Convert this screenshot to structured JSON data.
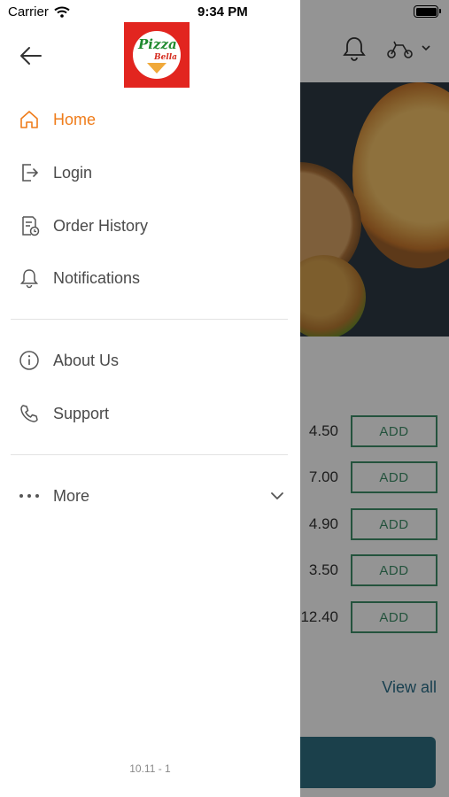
{
  "status_bar": {
    "carrier": "Carrier",
    "time": "9:34 PM"
  },
  "drawer": {
    "items": [
      {
        "label": "Home",
        "icon": "home-icon",
        "active": true
      },
      {
        "label": "Login",
        "icon": "login-icon"
      },
      {
        "label": "Order History",
        "icon": "order-history-icon"
      },
      {
        "label": "Notifications",
        "icon": "bell-icon"
      },
      {
        "label": "About Us",
        "icon": "info-icon"
      },
      {
        "label": "Support",
        "icon": "phone-icon"
      },
      {
        "label": "More",
        "icon": "more-dots-icon"
      }
    ],
    "version": "10.11 - 1",
    "accent_color": "#ef7c1a",
    "logo": {
      "line1": "Pizza",
      "line2": "Bella"
    }
  },
  "background": {
    "prices": [
      "4.50",
      "7.00",
      "4.90",
      "3.50",
      "12.40"
    ],
    "add_label": "ADD",
    "view_all": "View all"
  }
}
